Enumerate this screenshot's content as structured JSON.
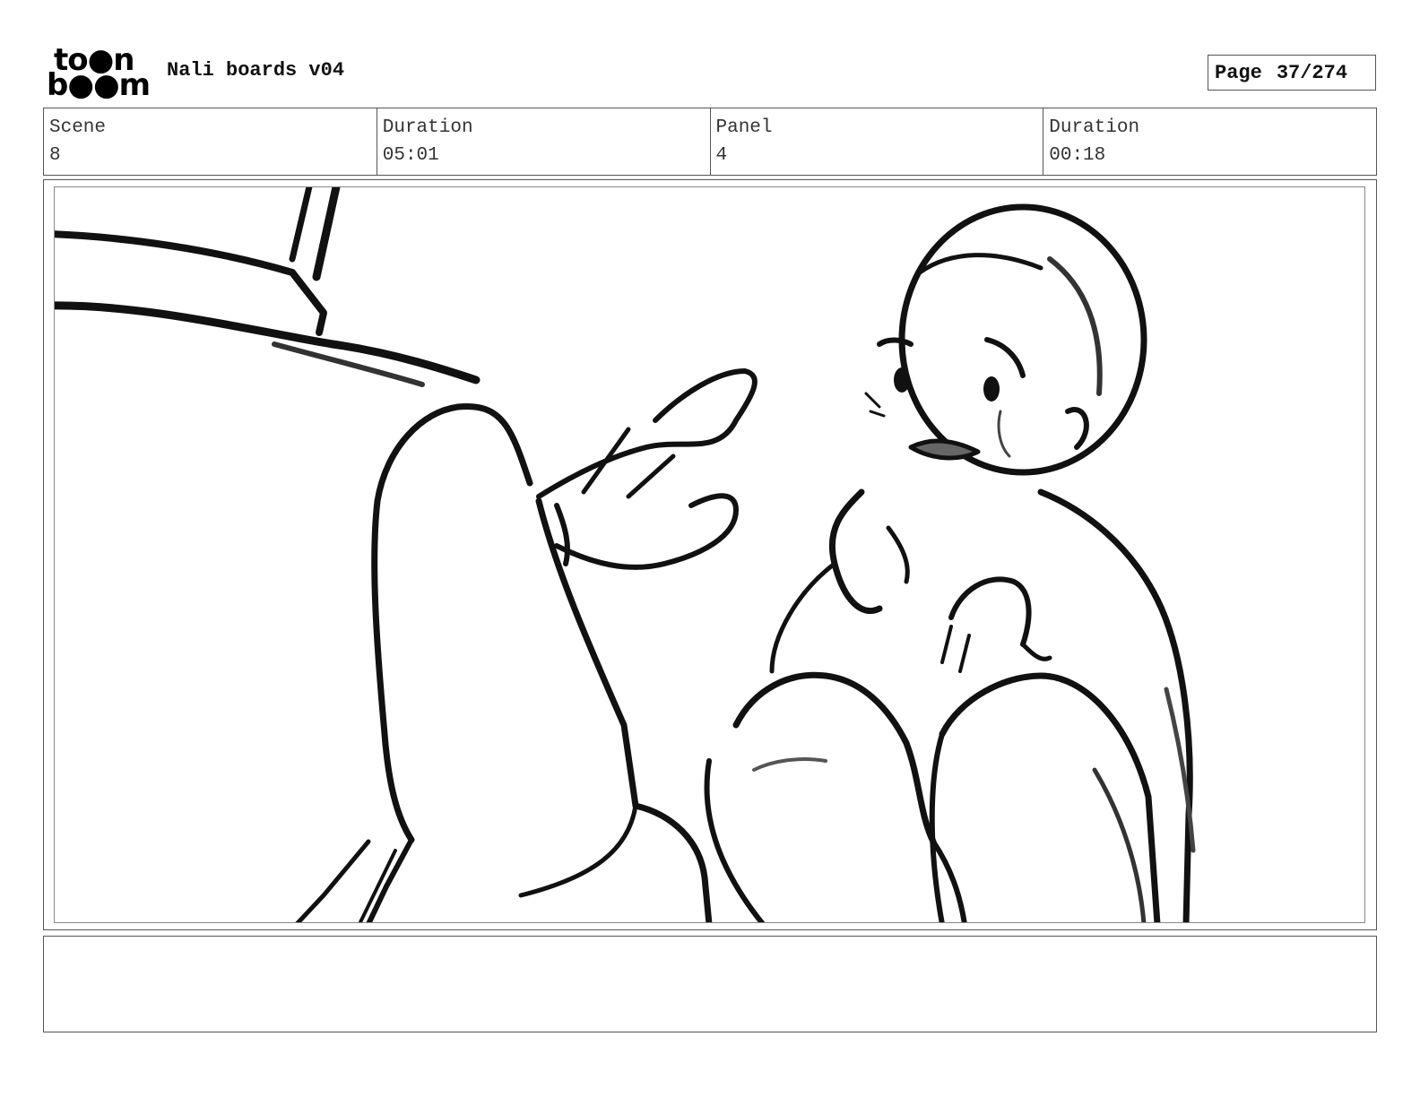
{
  "header": {
    "logo_line1": "to●n",
    "logo_line2": "b●●m",
    "title": "Nali boards v04",
    "page_label": "Page",
    "page_number": "37/274"
  },
  "info": [
    {
      "label": "Scene",
      "value": "8"
    },
    {
      "label": "Duration",
      "value": "05:01"
    },
    {
      "label": "Panel",
      "value": "4"
    },
    {
      "label": "Duration",
      "value": "00:18"
    }
  ],
  "notes": ""
}
